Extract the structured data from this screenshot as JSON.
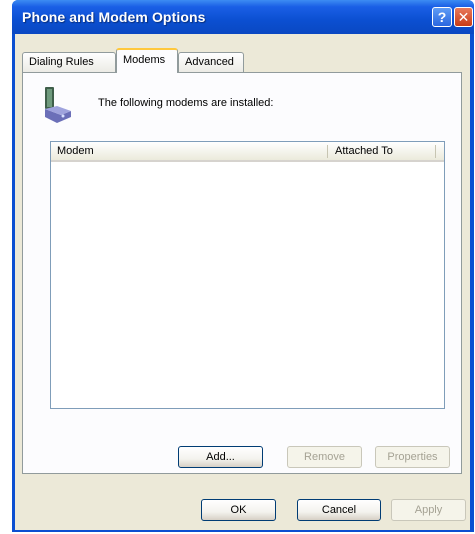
{
  "window": {
    "title": "Phone and Modem Options",
    "help_glyph": "?",
    "close_glyph": "✕"
  },
  "tabs": [
    {
      "label": "Dialing Rules",
      "active": false
    },
    {
      "label": "Modems",
      "active": true
    },
    {
      "label": "Advanced",
      "active": false
    }
  ],
  "panel": {
    "icon": "modem-icon",
    "intro_text": "The following modems are installed:",
    "columns": [
      "Modem",
      "Attached To"
    ],
    "rows": []
  },
  "panel_buttons": {
    "add": "Add...",
    "remove": "Remove",
    "properties": "Properties"
  },
  "dialog_buttons": {
    "ok": "OK",
    "cancel": "Cancel",
    "apply": "Apply"
  },
  "colors": {
    "titlebar": "#0b4fd1",
    "client": "#ece9d8",
    "tab_highlight": "#ffc83c",
    "close_button": "#c73b16"
  }
}
